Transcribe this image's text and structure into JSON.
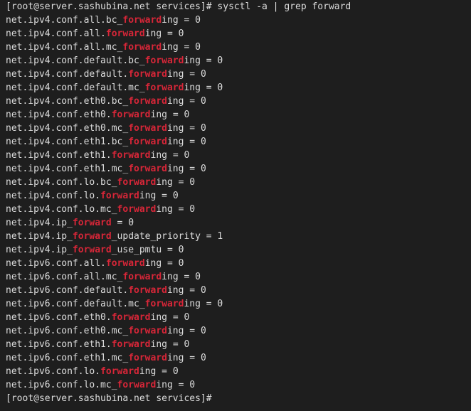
{
  "terminal": {
    "highlight_color": "#d72638",
    "text_color": "#dcdcdc",
    "background_color": "#1e1e1e",
    "prompt_line": {
      "segments": [
        {
          "text": "[root@server.sashubina.net services]# sysctl -a | grep forward",
          "hl": false
        }
      ]
    },
    "output_lines": [
      {
        "segments": [
          {
            "text": "net.ipv4.conf.all.bc_",
            "hl": false
          },
          {
            "text": "forward",
            "hl": true
          },
          {
            "text": "ing = 0",
            "hl": false
          }
        ]
      },
      {
        "segments": [
          {
            "text": "net.ipv4.conf.all.",
            "hl": false
          },
          {
            "text": "forward",
            "hl": true
          },
          {
            "text": "ing = 0",
            "hl": false
          }
        ]
      },
      {
        "segments": [
          {
            "text": "net.ipv4.conf.all.mc_",
            "hl": false
          },
          {
            "text": "forward",
            "hl": true
          },
          {
            "text": "ing = 0",
            "hl": false
          }
        ]
      },
      {
        "segments": [
          {
            "text": "net.ipv4.conf.default.bc_",
            "hl": false
          },
          {
            "text": "forward",
            "hl": true
          },
          {
            "text": "ing = 0",
            "hl": false
          }
        ]
      },
      {
        "segments": [
          {
            "text": "net.ipv4.conf.default.",
            "hl": false
          },
          {
            "text": "forward",
            "hl": true
          },
          {
            "text": "ing = 0",
            "hl": false
          }
        ]
      },
      {
        "segments": [
          {
            "text": "net.ipv4.conf.default.mc_",
            "hl": false
          },
          {
            "text": "forward",
            "hl": true
          },
          {
            "text": "ing = 0",
            "hl": false
          }
        ]
      },
      {
        "segments": [
          {
            "text": "net.ipv4.conf.eth0.bc_",
            "hl": false
          },
          {
            "text": "forward",
            "hl": true
          },
          {
            "text": "ing = 0",
            "hl": false
          }
        ]
      },
      {
        "segments": [
          {
            "text": "net.ipv4.conf.eth0.",
            "hl": false
          },
          {
            "text": "forward",
            "hl": true
          },
          {
            "text": "ing = 0",
            "hl": false
          }
        ]
      },
      {
        "segments": [
          {
            "text": "net.ipv4.conf.eth0.mc_",
            "hl": false
          },
          {
            "text": "forward",
            "hl": true
          },
          {
            "text": "ing = 0",
            "hl": false
          }
        ]
      },
      {
        "segments": [
          {
            "text": "net.ipv4.conf.eth1.bc_",
            "hl": false
          },
          {
            "text": "forward",
            "hl": true
          },
          {
            "text": "ing = 0",
            "hl": false
          }
        ]
      },
      {
        "segments": [
          {
            "text": "net.ipv4.conf.eth1.",
            "hl": false
          },
          {
            "text": "forward",
            "hl": true
          },
          {
            "text": "ing = 0",
            "hl": false
          }
        ]
      },
      {
        "segments": [
          {
            "text": "net.ipv4.conf.eth1.mc_",
            "hl": false
          },
          {
            "text": "forward",
            "hl": true
          },
          {
            "text": "ing = 0",
            "hl": false
          }
        ]
      },
      {
        "segments": [
          {
            "text": "net.ipv4.conf.lo.bc_",
            "hl": false
          },
          {
            "text": "forward",
            "hl": true
          },
          {
            "text": "ing = 0",
            "hl": false
          }
        ]
      },
      {
        "segments": [
          {
            "text": "net.ipv4.conf.lo.",
            "hl": false
          },
          {
            "text": "forward",
            "hl": true
          },
          {
            "text": "ing = 0",
            "hl": false
          }
        ]
      },
      {
        "segments": [
          {
            "text": "net.ipv4.conf.lo.mc_",
            "hl": false
          },
          {
            "text": "forward",
            "hl": true
          },
          {
            "text": "ing = 0",
            "hl": false
          }
        ]
      },
      {
        "segments": [
          {
            "text": "net.ipv4.ip_",
            "hl": false
          },
          {
            "text": "forward",
            "hl": true
          },
          {
            "text": " = 0",
            "hl": false
          }
        ]
      },
      {
        "segments": [
          {
            "text": "net.ipv4.ip_",
            "hl": false
          },
          {
            "text": "forward",
            "hl": true
          },
          {
            "text": "_update_priority = 1",
            "hl": false
          }
        ]
      },
      {
        "segments": [
          {
            "text": "net.ipv4.ip_",
            "hl": false
          },
          {
            "text": "forward",
            "hl": true
          },
          {
            "text": "_use_pmtu = 0",
            "hl": false
          }
        ]
      },
      {
        "segments": [
          {
            "text": "net.ipv6.conf.all.",
            "hl": false
          },
          {
            "text": "forward",
            "hl": true
          },
          {
            "text": "ing = 0",
            "hl": false
          }
        ]
      },
      {
        "segments": [
          {
            "text": "net.ipv6.conf.all.mc_",
            "hl": false
          },
          {
            "text": "forward",
            "hl": true
          },
          {
            "text": "ing = 0",
            "hl": false
          }
        ]
      },
      {
        "segments": [
          {
            "text": "net.ipv6.conf.default.",
            "hl": false
          },
          {
            "text": "forward",
            "hl": true
          },
          {
            "text": "ing = 0",
            "hl": false
          }
        ]
      },
      {
        "segments": [
          {
            "text": "net.ipv6.conf.default.mc_",
            "hl": false
          },
          {
            "text": "forward",
            "hl": true
          },
          {
            "text": "ing = 0",
            "hl": false
          }
        ]
      },
      {
        "segments": [
          {
            "text": "net.ipv6.conf.eth0.",
            "hl": false
          },
          {
            "text": "forward",
            "hl": true
          },
          {
            "text": "ing = 0",
            "hl": false
          }
        ]
      },
      {
        "segments": [
          {
            "text": "net.ipv6.conf.eth0.mc_",
            "hl": false
          },
          {
            "text": "forward",
            "hl": true
          },
          {
            "text": "ing = 0",
            "hl": false
          }
        ]
      },
      {
        "segments": [
          {
            "text": "net.ipv6.conf.eth1.",
            "hl": false
          },
          {
            "text": "forward",
            "hl": true
          },
          {
            "text": "ing = 0",
            "hl": false
          }
        ]
      },
      {
        "segments": [
          {
            "text": "net.ipv6.conf.eth1.mc_",
            "hl": false
          },
          {
            "text": "forward",
            "hl": true
          },
          {
            "text": "ing = 0",
            "hl": false
          }
        ]
      },
      {
        "segments": [
          {
            "text": "net.ipv6.conf.lo.",
            "hl": false
          },
          {
            "text": "forward",
            "hl": true
          },
          {
            "text": "ing = 0",
            "hl": false
          }
        ]
      },
      {
        "segments": [
          {
            "text": "net.ipv6.conf.lo.mc_",
            "hl": false
          },
          {
            "text": "forward",
            "hl": true
          },
          {
            "text": "ing = 0",
            "hl": false
          }
        ]
      }
    ],
    "final_prompt": {
      "segments": [
        {
          "text": "[root@server.sashubina.net services]#",
          "hl": false
        }
      ]
    }
  }
}
